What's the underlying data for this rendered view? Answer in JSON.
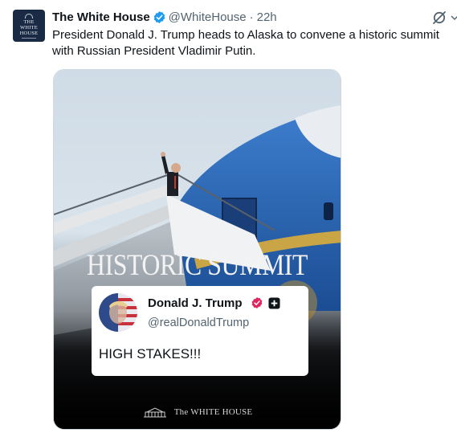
{
  "tweet": {
    "author_avatar_text": [
      "THE",
      "WHITE",
      "HOUSE"
    ],
    "display_name": "The White House",
    "handle": "@WhiteHouse",
    "separator": "·",
    "time": "22h",
    "text": "President Donald J. Trump heads to Alaska to convene a historic summit with Russian President Vladimir Putin.",
    "actions": {
      "grok_icon": "grok-icon",
      "more_icon": "chevron-down-icon"
    }
  },
  "media": {
    "headline": "HISTORIC SUMMIT",
    "embedded_post": {
      "display_name": "Donald J. Trump",
      "handle": "@realDonaldTrump",
      "text": "HIGH STAKES!!!",
      "badge_color": "#e0245e"
    },
    "footer_label": "The WHITE HOUSE"
  },
  "colors": {
    "verified": "#1d9bf0",
    "text": "#0f1419",
    "secondary": "#536471"
  }
}
